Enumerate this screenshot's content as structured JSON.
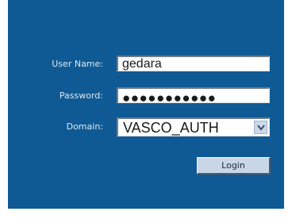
{
  "form": {
    "username": {
      "label": "User Name:",
      "value": "gedara"
    },
    "password": {
      "label": "Password:",
      "masked_value": "●●●●●●●●●●●"
    },
    "domain": {
      "label": "Domain:",
      "selected": "VASCO_AUTH"
    },
    "login_label": "Login"
  },
  "colors": {
    "panel_background": "#0f5a94",
    "label_text": "#dfe9f2",
    "button_face": "#c9d6e6"
  }
}
